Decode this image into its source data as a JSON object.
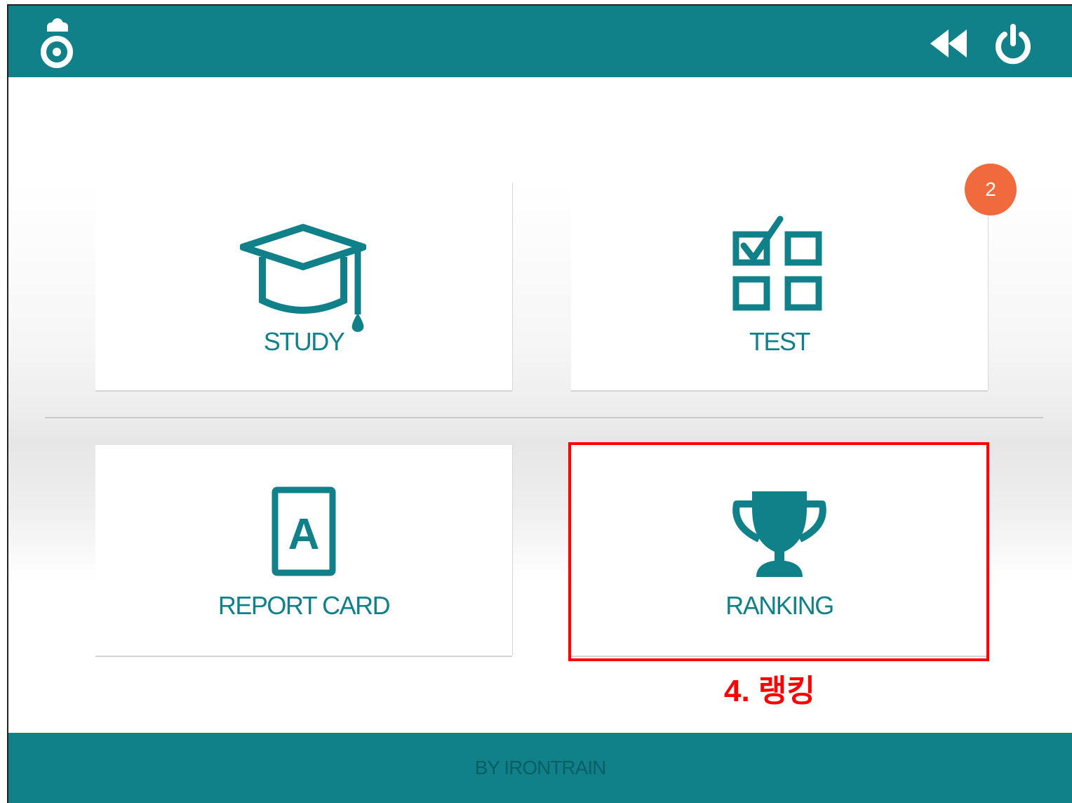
{
  "header": {
    "logo_icon": "app-logo-icon",
    "rewind_icon": "rewind-icon",
    "power_icon": "power-icon"
  },
  "tiles": [
    {
      "label": "STUDY",
      "icon": "graduation-cap-icon"
    },
    {
      "label": "TEST",
      "icon": "checklist-grid-icon",
      "badge": "2"
    },
    {
      "label": "REPORT CARD",
      "icon": "report-card-icon"
    },
    {
      "label": "RANKING",
      "icon": "trophy-icon"
    }
  ],
  "annotation": "4. 랭킹",
  "footer": {
    "text": "BY IRONTRAIN"
  },
  "colors": {
    "primary": "#108089",
    "badge": "#f06a3d",
    "annotation": "#ff0000"
  }
}
